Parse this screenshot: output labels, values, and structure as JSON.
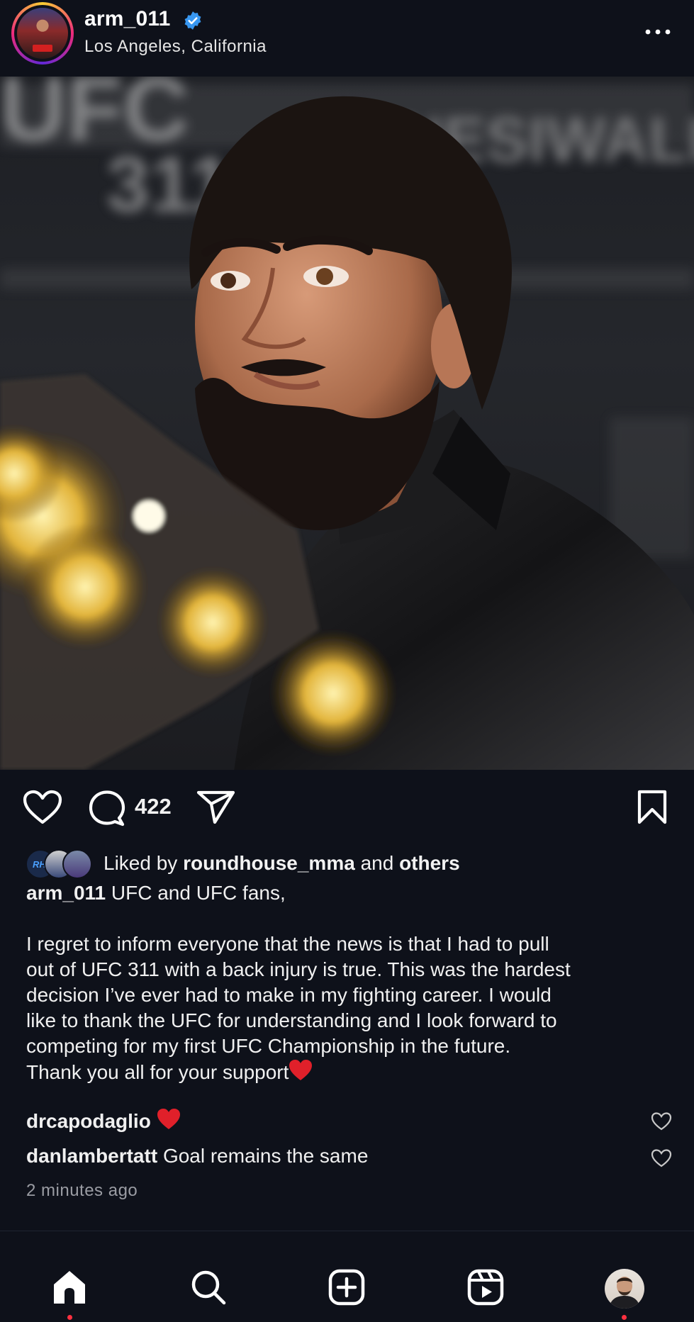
{
  "post": {
    "username": "arm_011",
    "location": "Los Angeles, California",
    "verified_badge_color": "#3897f0",
    "comment_count": "422",
    "liked_by_prefix": "Liked by",
    "liked_by_user": "roundhouse_mma",
    "liked_by_and": "and",
    "liked_by_others": "others",
    "caption_user": "arm_011",
    "caption_first": "UFC and UFC fans,",
    "caption_body_lines": [
      "I regret to inform everyone that the news is that I had to pull",
      "out of UFC 311 with a back injury is true. This was the hardest",
      "decision I’ve ever had to make in my fighting career. I would",
      "like to thank the UFC for understanding and I look forward to",
      "competing for my first UFC Championship in the future."
    ],
    "caption_last": "Thank you all for your support",
    "comments": [
      {
        "user": "drcapodaglio",
        "text": ""
      },
      {
        "user": "danlambertatt",
        "text": "Goal remains the same"
      }
    ],
    "timestamp": "2 minutes ago",
    "photo_background_text": "UFC 311"
  },
  "icons": {
    "like": "heart-icon",
    "comment": "comment-icon",
    "share": "send-icon",
    "save": "bookmark-icon",
    "more": "more-options-icon"
  },
  "navbar": {
    "items": [
      "home-icon",
      "search-icon",
      "create-icon",
      "reels-icon",
      "profile-icon"
    ]
  },
  "colors": {
    "background": "#0e111a",
    "accent_red": "#ff3040",
    "heart_emoji": "#e0202a"
  }
}
